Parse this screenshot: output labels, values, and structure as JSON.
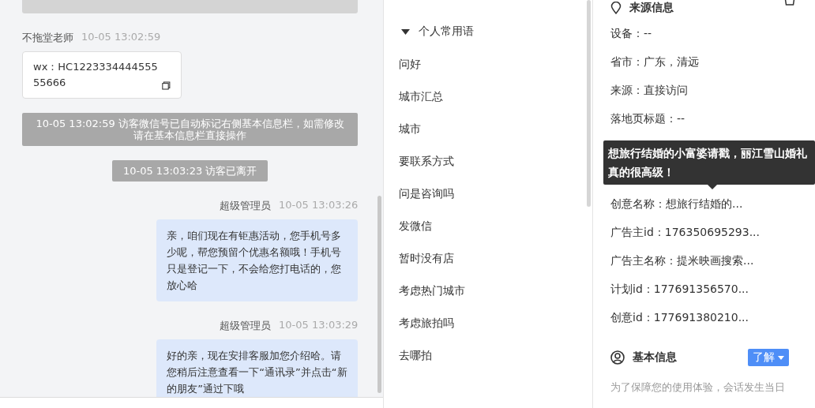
{
  "chat": {
    "messages": [
      {
        "kind": "incoming",
        "sender": "不拖堂老师",
        "time": "10-05 13:02:59",
        "text": "wx：HC122333444455555666"
      },
      {
        "kind": "system",
        "text": "10-05 13:02:59 访客微信号已自动标记右侧基本信息栏，如需修改请在基本信息栏直接操作"
      },
      {
        "kind": "system",
        "text": "10-05 13:03:23 访客已离开"
      },
      {
        "kind": "outgoing",
        "sender": "超级管理员",
        "time": "10-05 13:03:26",
        "text": "亲，咱们现在有钜惠活动，您手机号多少呢，帮您预留个优惠名额哦！手机号只是登记一下，不会给您打电话的，您放心哈"
      },
      {
        "kind": "outgoing",
        "sender": "超级管理员",
        "time": "10-05 13:03:29",
        "text": "好的亲，现在安排客服加您介绍哈。请您稍后注意查看一下“通讯录”并点击“新的朋友”通过下哦"
      }
    ]
  },
  "phrases": {
    "group": {
      "label": "个人常用语",
      "expanded": true
    },
    "items": [
      "问好",
      "城市汇总",
      "城市",
      "要联系方式",
      "问是咨询吗",
      "发微信",
      "暂时没有店",
      "考虑热门城市",
      "考虑旅拍吗",
      "去哪拍"
    ]
  },
  "source_info": {
    "title": "来源信息",
    "rows": [
      {
        "label": "设备：",
        "value": "--"
      },
      {
        "label": "省市：",
        "value": "广东，清远"
      },
      {
        "label": "来源：",
        "value": "直接访问"
      },
      {
        "label": "落地页标题：",
        "value": "--"
      },
      {
        "label": "创意名称：",
        "value": "想旅行结婚的...",
        "tooltip": "想旅行结婚的小富婆请戳，丽江雪山婚礼真的很高级！"
      },
      {
        "label": "广告主id：",
        "value": "176350695293..."
      },
      {
        "label": "广告主名称：",
        "value": "提米映画搜索..."
      },
      {
        "label": "计划id：",
        "value": "177691356570..."
      },
      {
        "label": "创意id：",
        "value": "177691380210..."
      }
    ]
  },
  "basic_info": {
    "title": "基本信息",
    "button": "了解",
    "notice": "为了保障您的使用体验，会话发生当日"
  }
}
